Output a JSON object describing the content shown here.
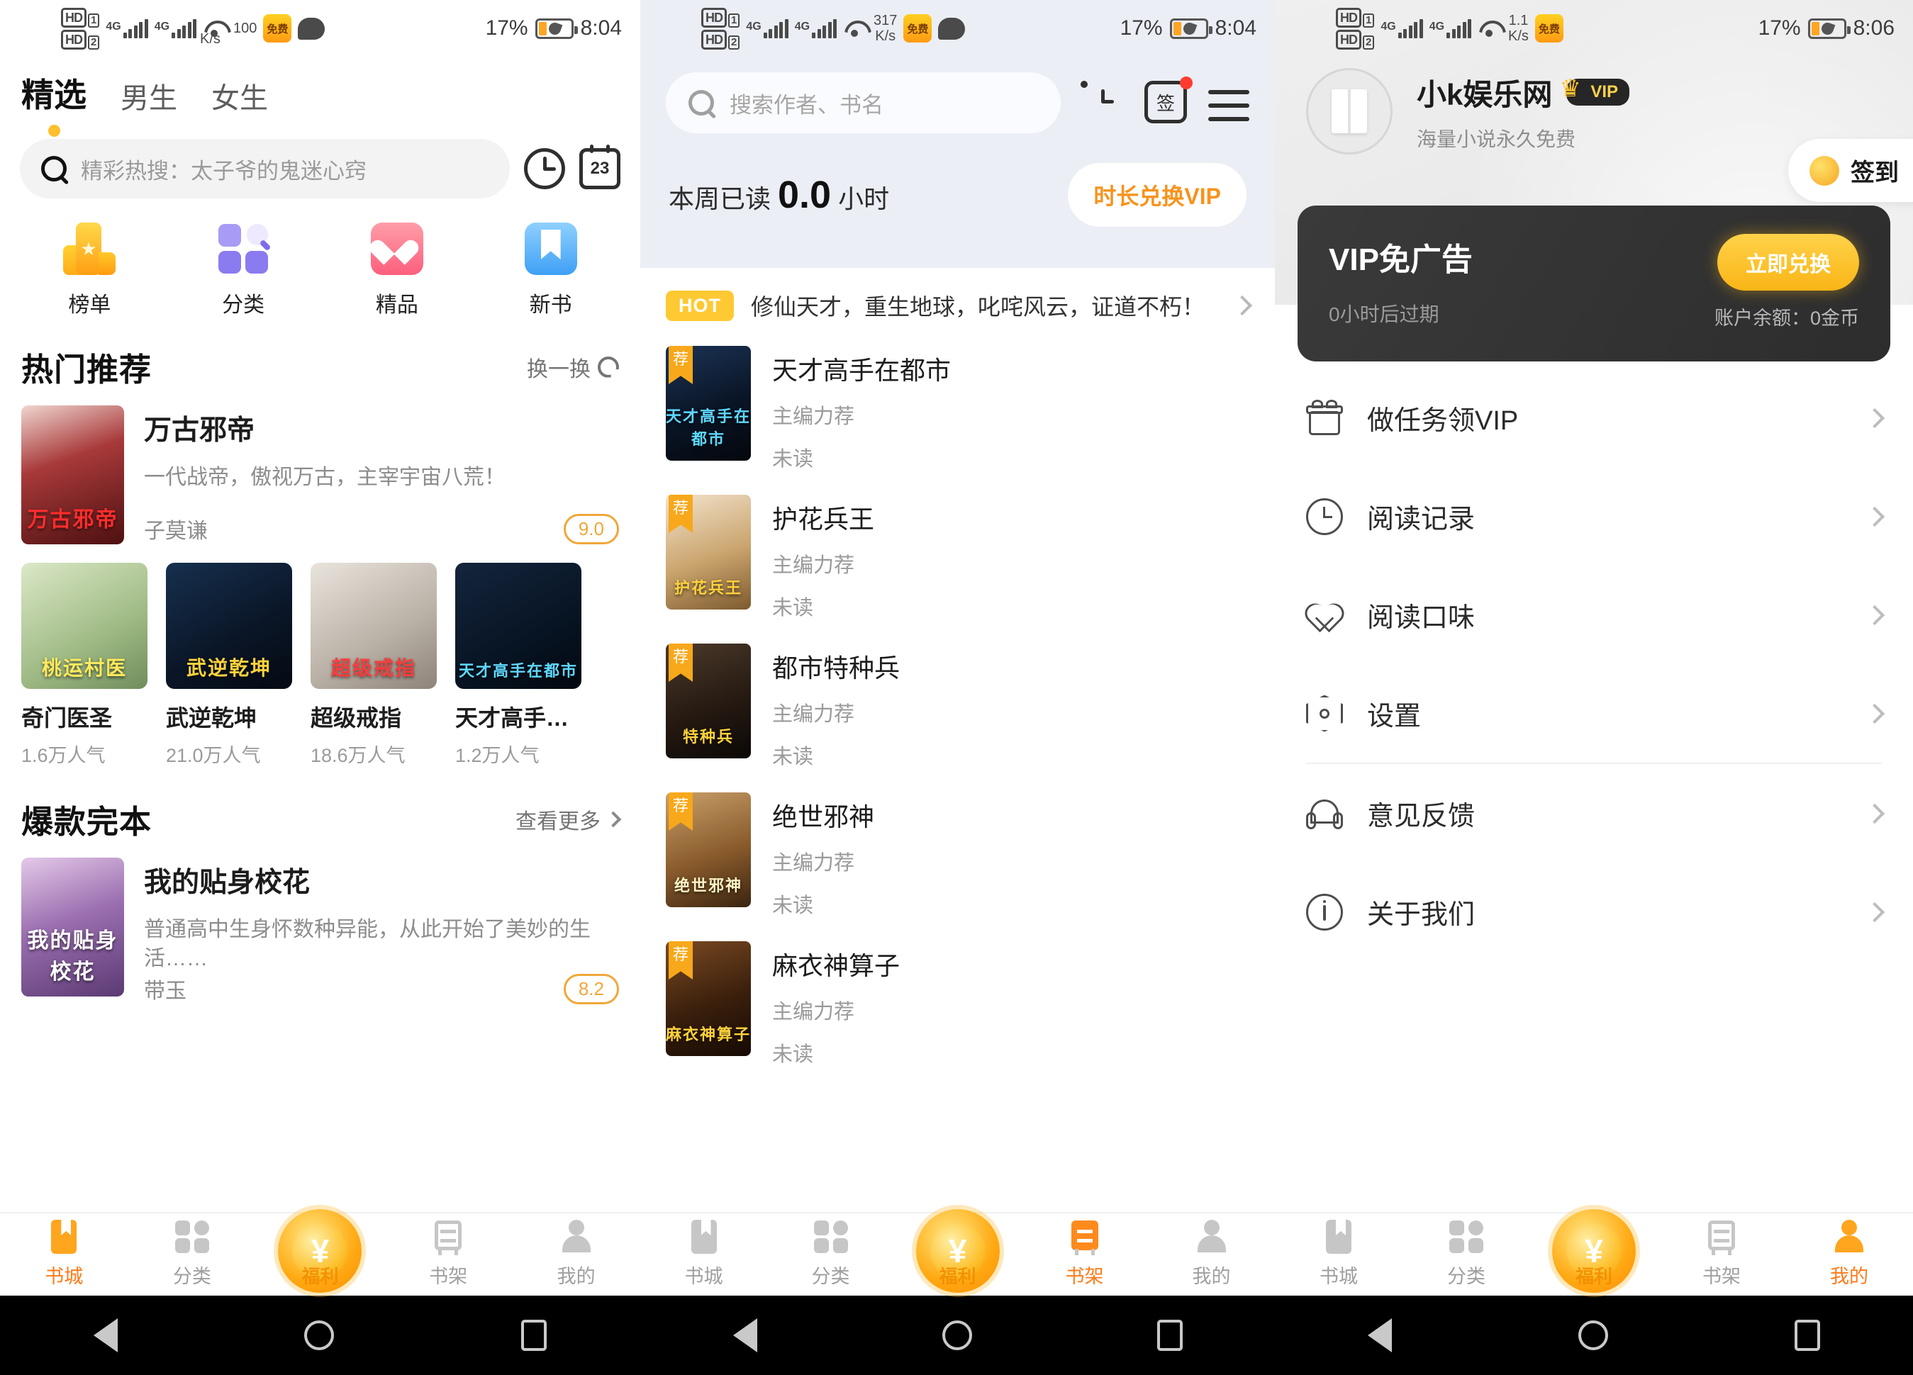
{
  "status_bars": {
    "left": {
      "hd1": "HD",
      "hd1_num": "1",
      "hd2": "HD",
      "hd2_num": "2",
      "net1": "4G",
      "net2": "4G",
      "free_badge": "免费"
    },
    "screen1": {
      "speed": "100",
      "speed_unit": "K/s",
      "battery_pct": "17%",
      "time": "8:04"
    },
    "screen2": {
      "speed": "317",
      "speed_unit": "K/s",
      "battery_pct": "17%",
      "time": "8:04"
    },
    "screen3": {
      "speed": "1.1",
      "speed_unit": "K/s",
      "battery_pct": "17%",
      "time": "8:06"
    }
  },
  "screen1": {
    "tabs": [
      {
        "label": "精选",
        "active": true
      },
      {
        "label": "男生",
        "active": false
      },
      {
        "label": "女生",
        "active": false
      }
    ],
    "search": {
      "placeholder": "精彩热搜：太子爷的鬼迷心窍"
    },
    "header_icons": {
      "history": "history-clock-icon",
      "calendar": "calendar-icon",
      "calendar_day": "23"
    },
    "quick_entries": [
      {
        "label": "榜单",
        "icon": "rank-icon"
      },
      {
        "label": "分类",
        "icon": "category-icon"
      },
      {
        "label": "精品",
        "icon": "premium-heart-icon"
      },
      {
        "label": "新书",
        "icon": "new-book-icon"
      }
    ],
    "hot_section": {
      "title": "热门推荐",
      "action": "换一换",
      "featured": {
        "title": "万古邪帝",
        "desc": "一代战帝，傲视万古，主宰宇宙八荒！",
        "author": "子莫谦",
        "score": "9.0",
        "cover_text": "万古邪帝"
      },
      "grid": [
        {
          "name": "奇门医圣",
          "popularity": "1.6万人气",
          "cover_text": "桃运村医"
        },
        {
          "name": "武逆乾坤",
          "popularity": "21.0万人气",
          "cover_text": "武逆乾坤"
        },
        {
          "name": "超级戒指",
          "popularity": "18.6万人气",
          "cover_text": "超级戒指"
        },
        {
          "name": "天才高手…",
          "popularity": "1.2万人气",
          "cover_text": "天才高手在都市"
        }
      ]
    },
    "complete_section": {
      "title": "爆款完本",
      "action": "查看更多",
      "featured": {
        "title": "我的贴身校花",
        "desc": "普通高中生身怀数种异能，从此开始了美妙的生活……",
        "author": "带玉",
        "score": "8.2",
        "cover_text": "我的贴身校花"
      }
    },
    "bottom_nav": [
      {
        "label": "书城",
        "icon": "bookstore-icon",
        "active": true
      },
      {
        "label": "分类",
        "icon": "category-icon",
        "active": false
      },
      {
        "label": "福利",
        "icon": "coin-welfare-icon",
        "active": false,
        "coin": "¥"
      },
      {
        "label": "书架",
        "icon": "bookshelf-icon",
        "active": false
      },
      {
        "label": "我的",
        "icon": "profile-icon",
        "active": false
      }
    ]
  },
  "screen2": {
    "search": {
      "placeholder": "搜索作者、书名"
    },
    "header_icons": {
      "history": "history-clock-icon",
      "signin": "签",
      "menu": "hamburger-menu-icon"
    },
    "reading_stat": {
      "prefix": "本周已读",
      "value": "0.0",
      "suffix": "小时",
      "button": "时长兑换VIP"
    },
    "hot_banner": {
      "badge": "HOT",
      "text": "修仙天才，重生地球，叱咤风云，证道不朽！"
    },
    "books": [
      {
        "title": "天才高手在都市",
        "sub": "主编力荐",
        "state": "未读",
        "flag": "荐",
        "cover_text": "天才高手在都市"
      },
      {
        "title": "护花兵王",
        "sub": "主编力荐",
        "state": "未读",
        "flag": "荐",
        "cover_text": "护花兵王"
      },
      {
        "title": "都市特种兵",
        "sub": "主编力荐",
        "state": "未读",
        "flag": "荐",
        "cover_text": "特种兵"
      },
      {
        "title": "绝世邪神",
        "sub": "主编力荐",
        "state": "未读",
        "flag": "荐",
        "cover_text": "绝世邪神"
      },
      {
        "title": "麻衣神算子",
        "sub": "主编力荐",
        "state": "未读",
        "flag": "荐",
        "cover_text": "麻衣神算子"
      }
    ],
    "bottom_nav": [
      {
        "label": "书城",
        "icon": "bookstore-icon",
        "active": false
      },
      {
        "label": "分类",
        "icon": "category-icon",
        "active": false
      },
      {
        "label": "福利",
        "icon": "coin-welfare-icon",
        "active": false,
        "coin": "¥"
      },
      {
        "label": "书架",
        "icon": "bookshelf-icon",
        "active": true
      },
      {
        "label": "我的",
        "icon": "profile-icon",
        "active": false
      }
    ]
  },
  "screen3": {
    "profile": {
      "name": "小k娱乐网",
      "vip_badge": "VIP",
      "subtitle": "海量小说永久免费",
      "signin_button": "签到"
    },
    "vip_card": {
      "title": "VIP免广告",
      "expire": "0小时后过期",
      "button": "立即兑换",
      "balance": "账户余额：0金币"
    },
    "menu": [
      {
        "label": "做任务领VIP",
        "icon": "gift-icon"
      },
      {
        "label": "阅读记录",
        "icon": "clock-icon"
      },
      {
        "label": "阅读口味",
        "icon": "heart-icon"
      },
      {
        "label": "设置",
        "icon": "gear-icon"
      },
      {
        "label": "意见反馈",
        "icon": "headset-icon"
      },
      {
        "label": "关于我们",
        "icon": "info-icon"
      }
    ],
    "bottom_nav": [
      {
        "label": "书城",
        "icon": "bookstore-icon",
        "active": false
      },
      {
        "label": "分类",
        "icon": "category-icon",
        "active": false
      },
      {
        "label": "福利",
        "icon": "coin-welfare-icon",
        "active": false,
        "coin": "¥"
      },
      {
        "label": "书架",
        "icon": "bookshelf-icon",
        "active": false
      },
      {
        "label": "我的",
        "icon": "profile-icon",
        "active": true
      }
    ]
  },
  "android_nav": {
    "back": "back-triangle-icon",
    "home": "home-circle-icon",
    "recent": "recent-square-icon"
  }
}
